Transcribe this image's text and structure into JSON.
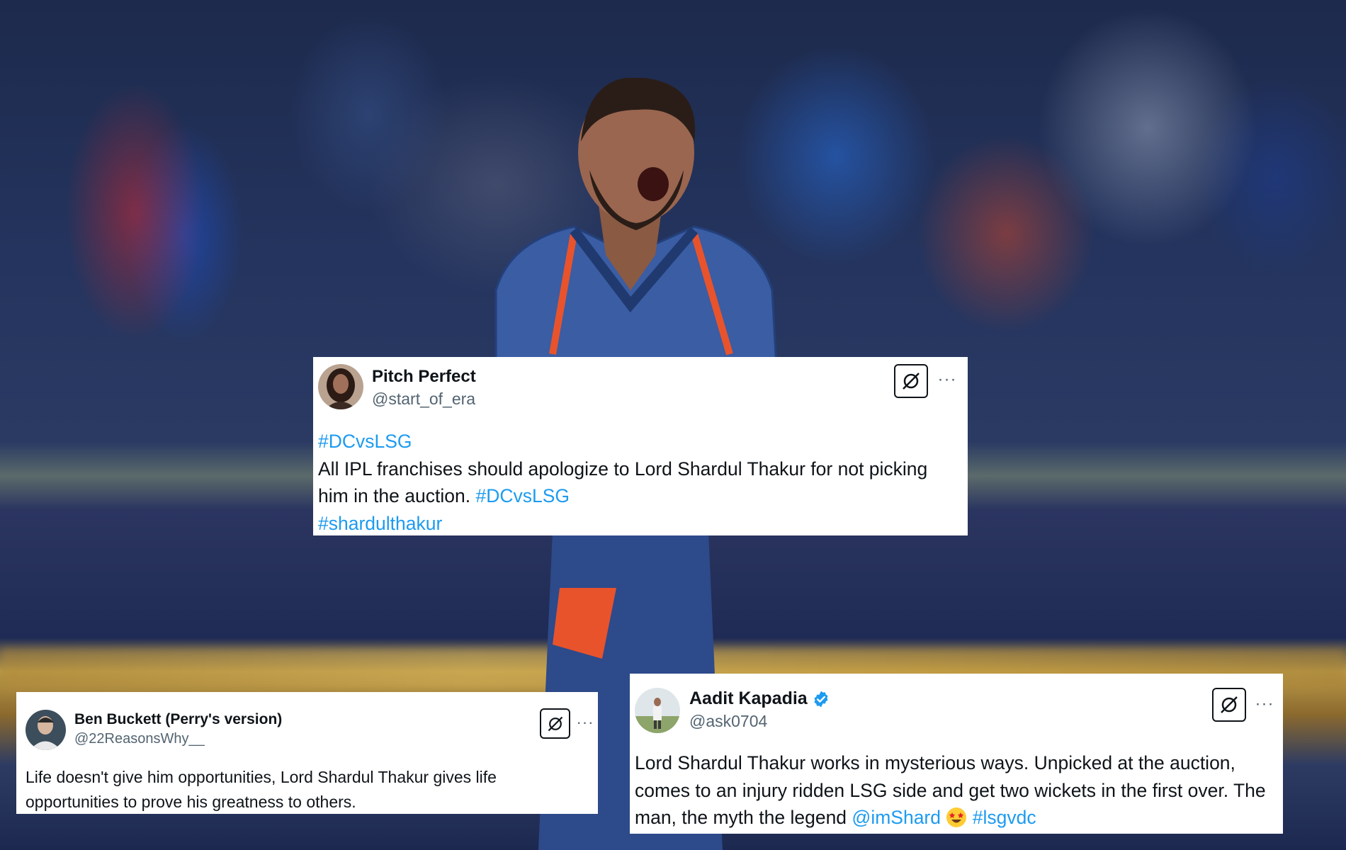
{
  "tweets": [
    {
      "name": "Pitch Perfect",
      "handle": "@start_of_era",
      "verified": false,
      "line1_tag": "#DCvsLSG",
      "text": "All IPL franchises should apologize to Lord Shardul Thakur for not picking him in the auction.",
      "inline_tag": "#DCvsLSG",
      "last_tag": "#shardulthakur"
    },
    {
      "name": "Ben Buckett (Perry's version)",
      "handle": "@22ReasonsWhy__",
      "verified": false,
      "text": "Life doesn't give him opportunities, Lord Shardul Thakur gives life opportunities to prove his greatness to others."
    },
    {
      "name": "Aadit Kapadia",
      "handle": "@ask0704",
      "verified": true,
      "text": "Lord Shardul Thakur works in mysterious ways. Unpicked at the auction, comes to an injury ridden LSG side and get two wickets in the first over. The man, the myth the legend",
      "mention": "@imShard",
      "emoji": "star-struck",
      "hashtag": "#lsgvdc"
    }
  ],
  "more_label": "···",
  "colors": {
    "link": "#1d9bf0",
    "verified": "#1d9bf0",
    "text": "#0f1419",
    "handle": "#536471",
    "card": "#ffffff"
  },
  "icons": {
    "grok": "grok-icon",
    "more": "more-icon",
    "verified": "verified-badge-icon"
  }
}
